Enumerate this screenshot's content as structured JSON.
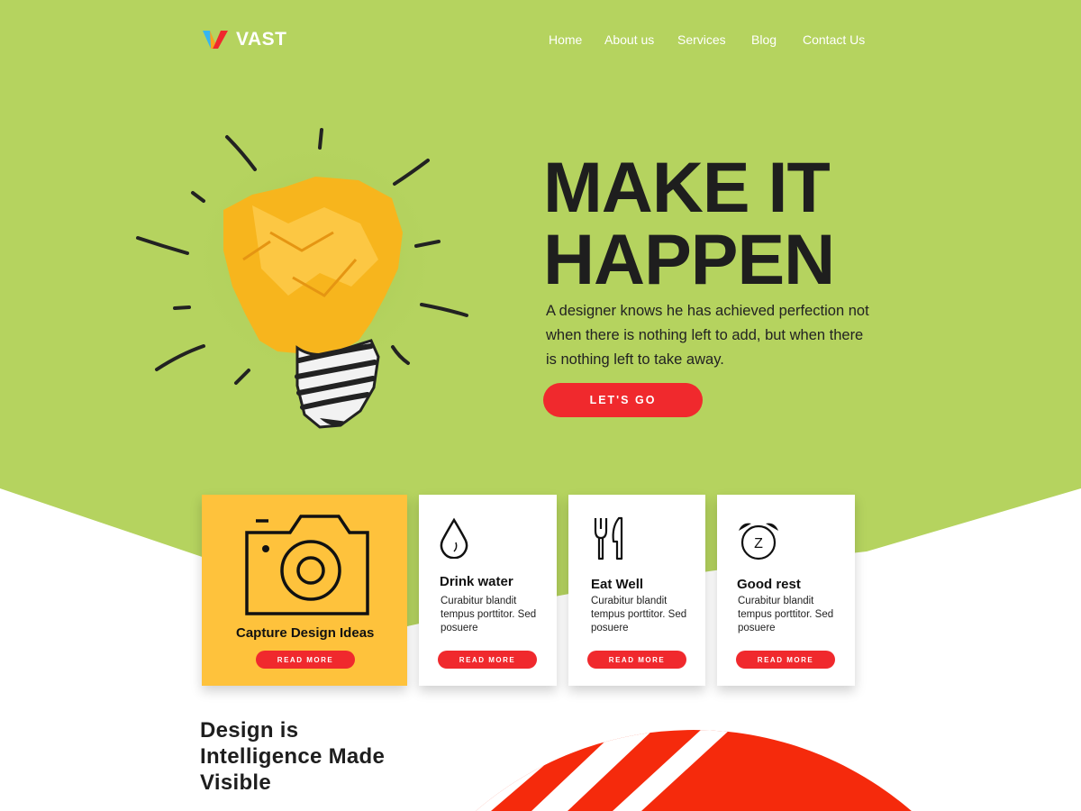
{
  "brand": {
    "name": "VAST",
    "colors": {
      "green": "#b5d35f",
      "accent": "#f0292d",
      "yellow": "#fec23c",
      "dark": "#1e1e1e"
    }
  },
  "nav": [
    {
      "label": "Home"
    },
    {
      "label": "About us"
    },
    {
      "label": "Services"
    },
    {
      "label": "Blog"
    },
    {
      "label": "Contact Us"
    }
  ],
  "hero": {
    "title_line1": "MAKE IT",
    "title_line2": "HAPPEN",
    "text": "A designer knows he has achieved perfection not when there is nothing left to add, but when there is nothing left to take away.",
    "button": "LET'S GO",
    "image_icon": "crumpled-paper-lightbulb"
  },
  "cards": [
    {
      "icon": "camera-icon",
      "title": "Capture Design Ideas",
      "body": "",
      "button": "READ MORE"
    },
    {
      "icon": "water-drop-icon",
      "title": "Drink water",
      "body": "Curabitur blandit tempus porttitor. Sed posuere",
      "button": "READ MORE"
    },
    {
      "icon": "fork-knife-icon",
      "title": "Eat Well",
      "body": "Curabitur blandit tempus porttitor. Sed posuere",
      "button": "READ MORE"
    },
    {
      "icon": "alarm-clock-icon",
      "title": "Good rest",
      "body": "Curabitur blandit tempus porttitor. Sed posuere",
      "button": "READ MORE"
    }
  ],
  "bottom": {
    "title": "Design is Intelligence Made Visible"
  }
}
